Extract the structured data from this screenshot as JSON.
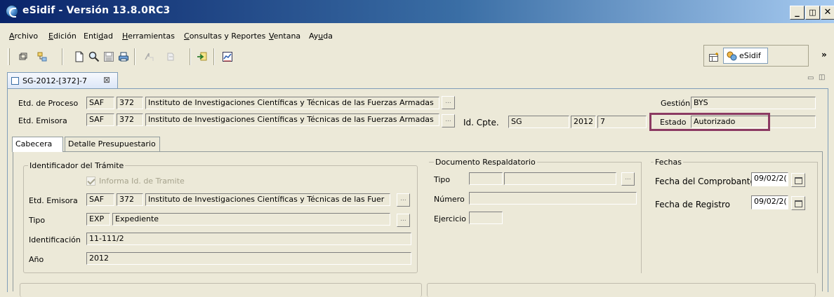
{
  "window": {
    "title": "eSidif - Versión 13.8.0RC3",
    "minimize": "_",
    "restore": "🗗",
    "close": "✕"
  },
  "menu": [
    "Archivo",
    "Edición",
    "Entidad",
    "Herramientas",
    "Consultas y Reportes",
    "Ventana",
    "Ayuda"
  ],
  "menu_mnemonics": [
    "A",
    "E",
    "d",
    "H",
    "C",
    "V",
    "u"
  ],
  "toolbar": {
    "perspective_label": "eSidif",
    "overflow": "»",
    "icons": [
      "restore-view-icon",
      "link-icon",
      "new-document-icon",
      "search-icon",
      "save-icon",
      "print-icon",
      "step-forward-icon",
      "step-back-icon",
      "import-icon",
      "report-icon"
    ]
  },
  "editor": {
    "tab_title": "SG-2012-[372]-7",
    "tab_close": "⊠",
    "view_controls": "▭ 🗗"
  },
  "header": {
    "etd_proceso": {
      "label": "Etd. de Proceso",
      "code1": "SAF",
      "code2": "372",
      "name": "Instituto de Investigaciones Científicas y Técnicas de las Fuerzas Armadas"
    },
    "etd_emisora": {
      "label": "Etd. Emisora",
      "code1": "SAF",
      "code2": "372",
      "name": "Instituto de Investigaciones Científicas y Técnicas de las Fuerzas Armadas"
    },
    "id_cpte": {
      "label": "Id. Cpte.",
      "tipo": "SG",
      "anio": "2012",
      "numero": "7"
    },
    "gestion": {
      "label": "Gestión",
      "value": "BYS"
    },
    "estado": {
      "label": "Estado",
      "value": "Autorizado"
    },
    "ellipsis": "..."
  },
  "tabs": [
    "Cabecera",
    "Detalle Presupuestario"
  ],
  "identificador": {
    "title": "Identificador del Trámite",
    "informa_label": "Informa Id. de Tramite",
    "etd_emisora": {
      "label": "Etd. Emisora",
      "code1": "SAF",
      "code2": "372",
      "name": "Instituto de Investigaciones Científicas y Técnicas de las Fuer"
    },
    "tipo": {
      "label": "Tipo",
      "code": "EXP",
      "name": "Expediente"
    },
    "identificacion": {
      "label": "Identificación",
      "value": "11-111/2"
    },
    "anio": {
      "label": "Año",
      "value": "2012"
    }
  },
  "documento": {
    "title": "Documento Respaldatorio",
    "tipo_label": "Tipo",
    "numero_label": "Número",
    "ejercicio_label": "Ejercicio"
  },
  "fechas": {
    "title": "Fechas",
    "comprobante_label": "Fecha del Comprobante",
    "comprobante_value": "09/02/2(",
    "registro_label": "Fecha de Registro",
    "registro_value": "09/02/2("
  }
}
